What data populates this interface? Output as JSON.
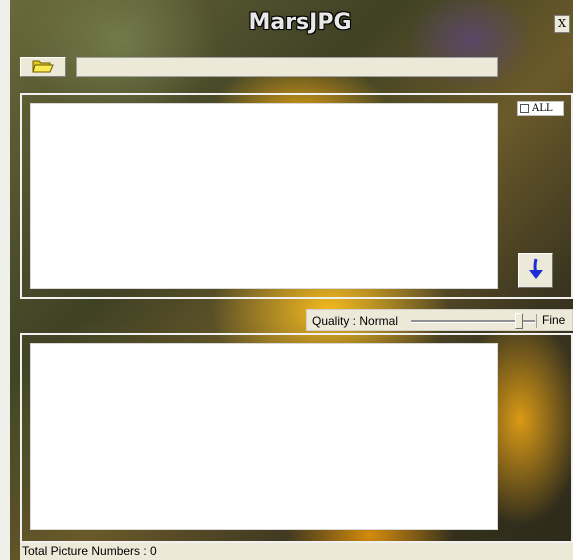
{
  "window": {
    "title": "MarsJPG",
    "close_label": "X"
  },
  "toolbar": {
    "folder_icon": "folder-open-icon",
    "path_value": ""
  },
  "source_list": {
    "all_label": "ALL",
    "all_checked": false,
    "items": []
  },
  "convert": {
    "arrow_icon": "arrow-down-icon"
  },
  "quality": {
    "label": "Quality : Normal",
    "fine_label": "Fine",
    "level": 0.9
  },
  "output_list": {
    "items": []
  },
  "status": {
    "text": "Total Picture Numbers : 0"
  },
  "colors": {
    "arrow": "#1e2cd8",
    "folder": "#f5e23a"
  }
}
